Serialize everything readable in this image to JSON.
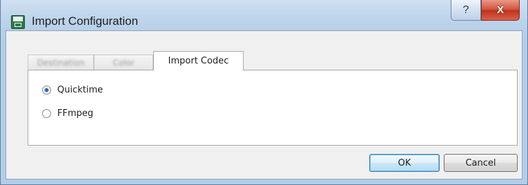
{
  "window": {
    "title": "Import Configuration",
    "app_icon": "app-logo-icon",
    "help_glyph": "?",
    "close_glyph": "X"
  },
  "tabs": [
    {
      "label": "Destination",
      "state": "blurred"
    },
    {
      "label": "Color",
      "state": "blurred"
    },
    {
      "label": "Import Codec",
      "state": "active"
    }
  ],
  "codec_options": [
    {
      "label": "Quicktime",
      "checked": true
    },
    {
      "label": "FFmpeg",
      "checked": false
    }
  ],
  "buttons": {
    "ok": "OK",
    "cancel": "Cancel"
  },
  "colors": {
    "titlebar": "#b3cde8",
    "close_button": "#c0311c",
    "default_button_border": "#3c7fb1"
  }
}
